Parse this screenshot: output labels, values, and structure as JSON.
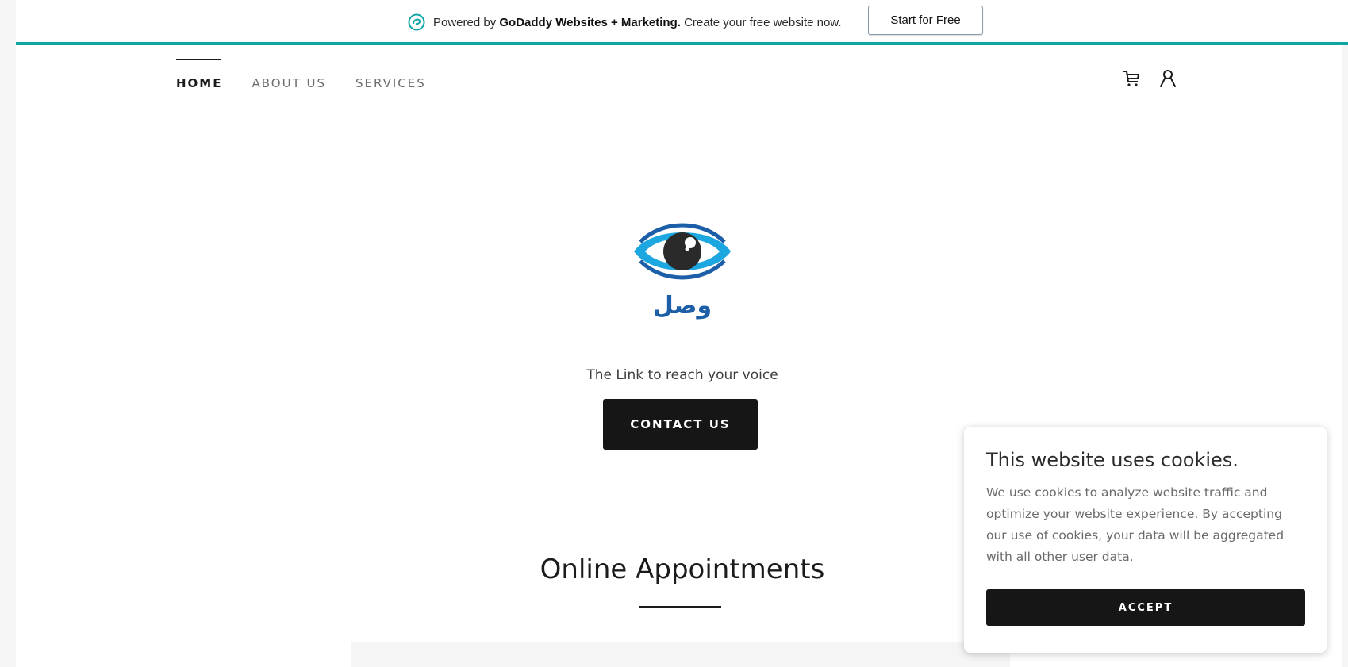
{
  "promo": {
    "powered_by": "Powered by ",
    "brand": "GoDaddy Websites + Marketing.",
    "cta_text": " Create your free website now.",
    "button_label": "Start for Free"
  },
  "nav": {
    "items": [
      {
        "label": "HOME",
        "active": true
      },
      {
        "label": "ABOUT US",
        "active": false
      },
      {
        "label": "SERVICES",
        "active": false
      }
    ],
    "icons": [
      "cart-icon",
      "account-icon"
    ]
  },
  "hero": {
    "logo_icon": "eye-logo-icon",
    "logo_text": "وصل",
    "tagline": "The Link to reach your voice",
    "contact_button": "CONTACT US"
  },
  "section": {
    "title": "Online Appointments"
  },
  "cookie": {
    "title": "This website uses cookies.",
    "body": "We use cookies to analyze website traffic and optimize your website experience. By accepting our use of cookies, your data will be aggregated with all other user data.",
    "accept_label": "ACCEPT"
  },
  "colors": {
    "accent_teal": "#12a5a5",
    "logo_blue_light": "#1ca7e0",
    "logo_blue_dark": "#1d5ea8",
    "button_dark": "#161616"
  }
}
